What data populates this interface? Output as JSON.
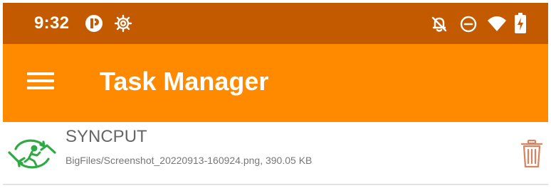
{
  "colors": {
    "status_bar": "#c35a00",
    "app_bar": "#ff8a00",
    "task_icon": "#2eaa44",
    "delete_icon": "#d88260"
  },
  "status_bar": {
    "time": "9:32",
    "left_icons": [
      "app-notification-icon",
      "settings-gear-icon"
    ],
    "right_icons": [
      "bell-off-icon",
      "do-not-disturb-icon",
      "wifi-icon",
      "battery-charging-icon"
    ]
  },
  "app_bar": {
    "menu_icon": "hamburger-menu-icon",
    "title": "Task Manager"
  },
  "tasks": [
    {
      "icon": "sync-put-icon",
      "type": "SYNCPUT",
      "detail": "BigFiles/Screenshot_20220913-160924.png, 390.05 KB",
      "action_icon": "trash-icon"
    }
  ]
}
